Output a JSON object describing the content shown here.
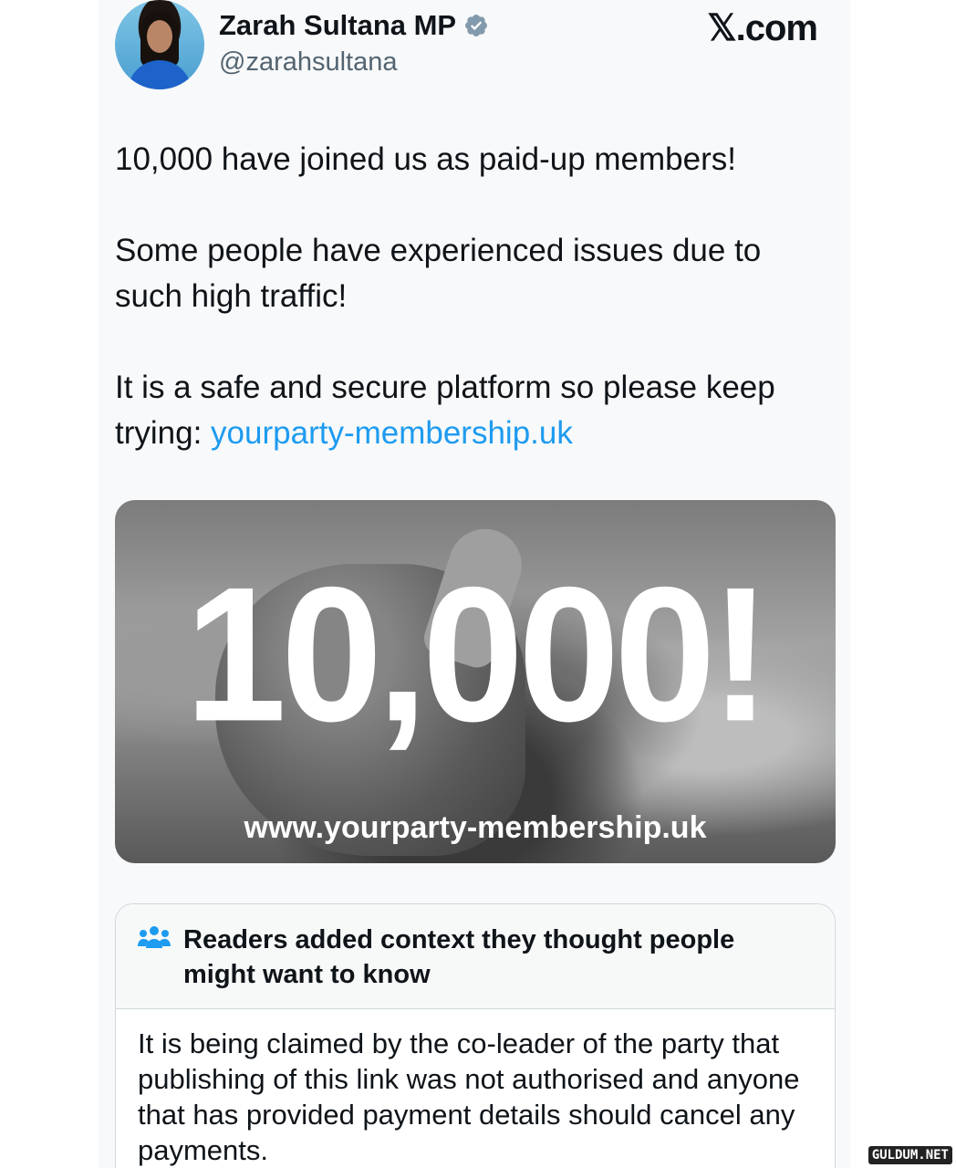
{
  "author": {
    "display_name": "Zarah Sultana MP",
    "handle": "@zarahsultana"
  },
  "site_label": "𝕏.com",
  "tweet": {
    "line1": "10,000 have joined us as paid-up members!",
    "line2": "Some people have experienced issues due to such high traffic!",
    "line3_prefix": "It is a safe and secure platform so please keep trying: ",
    "link": "yourparty-membership.uk"
  },
  "media": {
    "headline": "10,000!",
    "url": "www.yourparty-membership.uk"
  },
  "community_note": {
    "title": "Readers added context they thought people might want to know",
    "body": "It is being claimed by the co-leader of the party that publishing of this link was not authorised and anyone that has provided payment details should cancel any payments."
  },
  "watermark": "GULDUM.NET",
  "colors": {
    "link": "#1d9bf0",
    "verified_badge": "#829aab"
  }
}
